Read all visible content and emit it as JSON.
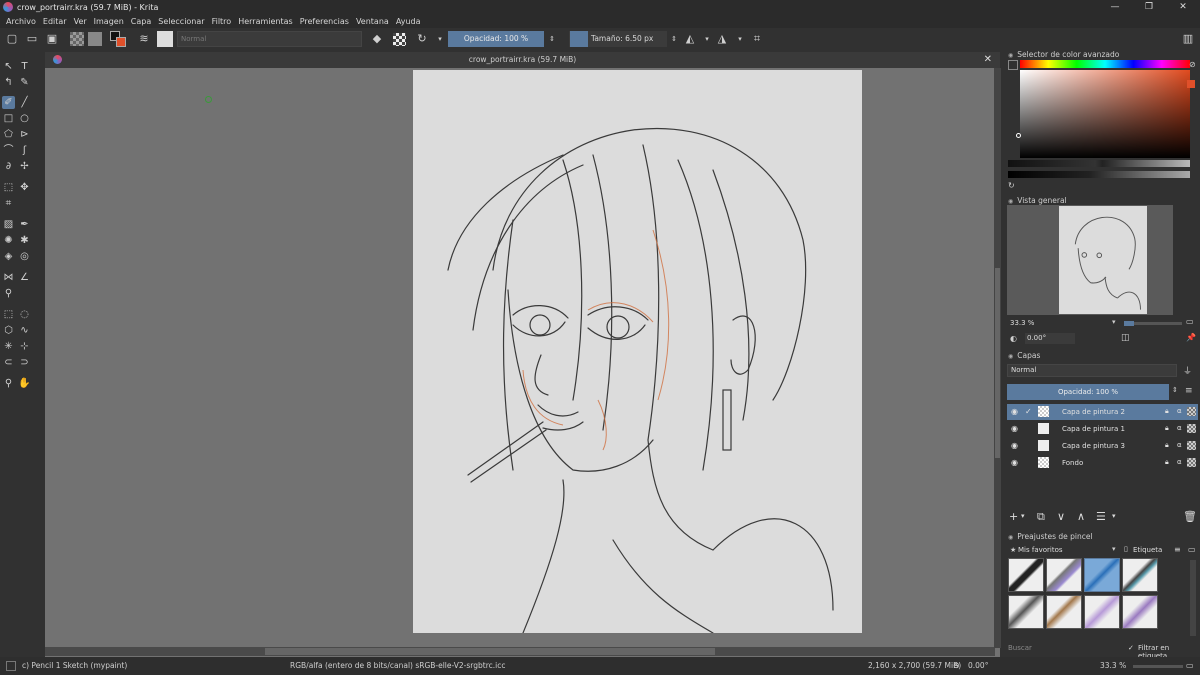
{
  "window": {
    "title": "crow_portrairr.kra (59.7 MiB)  - Krita",
    "buttons": {
      "minimize": "—",
      "maximize": "❐",
      "close": "✕"
    }
  },
  "menu": [
    "Archivo",
    "Editar",
    "Ver",
    "Imagen",
    "Capa",
    "Seleccionar",
    "Filtro",
    "Herramientas",
    "Preferencias",
    "Ventana",
    "Ayuda"
  ],
  "toolbar": {
    "blend_mode": "Normal",
    "opacity": "Opacidad: 100 %",
    "size": "Tamaño: 6.50 px"
  },
  "document": {
    "tab_title": "crow_portrairr.kra (59.7 MiB)",
    "close": "✕"
  },
  "dockers": {
    "color": {
      "title": "Selector de color avanzado"
    },
    "overview": {
      "title": "Vista general",
      "zoom": "33.3 %",
      "rotation": "0.00°"
    },
    "layers": {
      "title": "Capas",
      "blend_mode": "Normal",
      "opacity": "Opacidad:  100 %",
      "items": [
        {
          "name": "Capa de pintura 2",
          "selected": true
        },
        {
          "name": "Capa de pintura 1",
          "selected": false
        },
        {
          "name": "Capa de pintura 3",
          "selected": false
        },
        {
          "name": "Fondo",
          "selected": false
        }
      ]
    },
    "brush_presets": {
      "title": "Preajustes de pincel",
      "tag": "Mis favoritos",
      "tag_button": "Etiqueta",
      "search_placeholder": "Buscar",
      "filter_label": "Filtrar en etiqueta"
    }
  },
  "statusbar": {
    "brush": "c) Pencil 1 Sketch (mypaint)",
    "colorspace": "RGB/alfa (entero de 8 bits/canal)  sRGB-elle-V2-srgbtrc.icc",
    "dimensions": "2,160 x 2,700 (59.7 MiB)",
    "rotation": "0.00°",
    "zoom": "33.3 %"
  },
  "colors": {
    "accent": "#5a7a9e",
    "foreground": "#e0502a",
    "canvas": "#dcdcdc"
  }
}
